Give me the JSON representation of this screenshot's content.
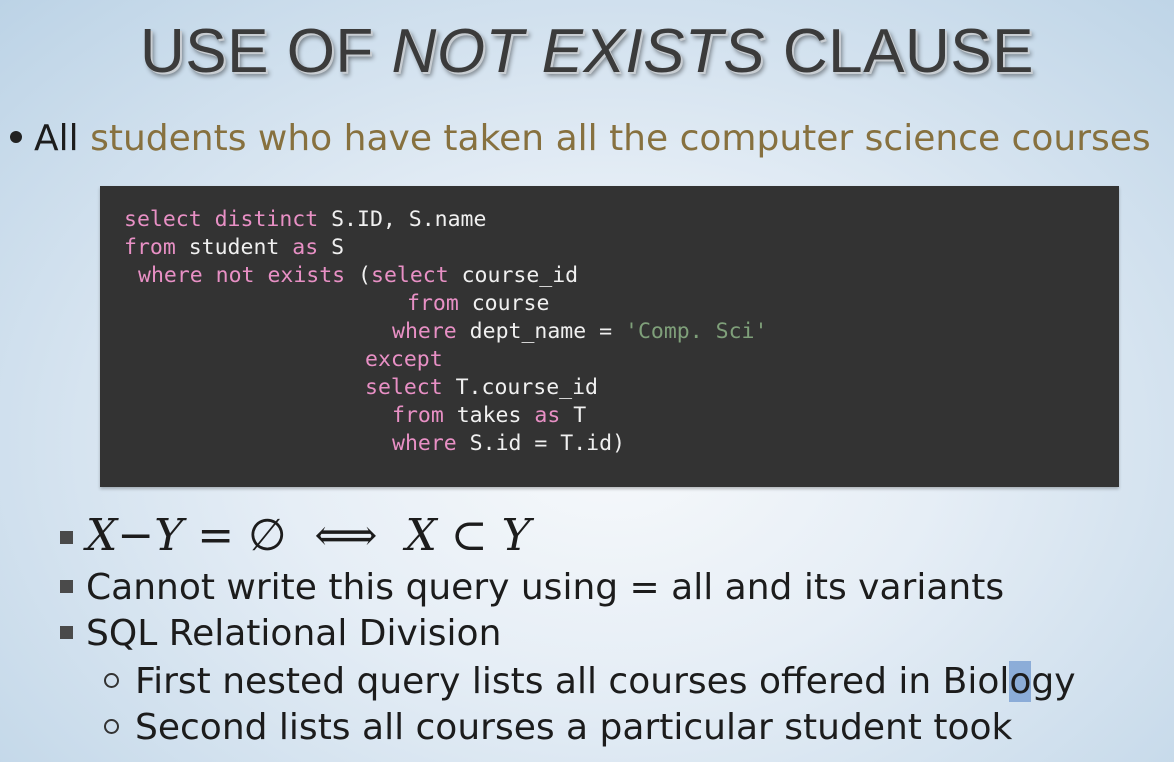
{
  "title": {
    "part1": "USE OF",
    "part2": "NOT EXISTS",
    "part3": "CLAUSE"
  },
  "main_bullet": {
    "lead": "All",
    "accent": "students who have taken all the computer science courses"
  },
  "code": {
    "line1": {
      "kw1": "select distinct",
      "rest": " S.ID, S.name"
    },
    "line2": {
      "kw1": "from",
      "mid": " student ",
      "kw2": "as",
      "rest": " S"
    },
    "line3": {
      "kw1": "where not exists",
      "mid": " (",
      "kw2": "select",
      "rest": " course_id"
    },
    "line4": {
      "kw1": "from",
      "rest": " course"
    },
    "line5": {
      "kw1": "where",
      "mid": " dept_name = ",
      "str": "'Comp. Sci'"
    },
    "line6": {
      "kw1": "except"
    },
    "line7": {
      "kw1": "select",
      "rest": " T.course_id"
    },
    "line8": {
      "kw1": "from",
      "mid": " takes ",
      "kw2": "as",
      "rest": " T"
    },
    "line9": {
      "kw1": "where",
      "rest": " S.id = T.id)"
    }
  },
  "sub_bullets": [
    {
      "math": {
        "x": "X",
        "minus": "−",
        "y": "Y",
        "eq": " = ∅  ⟺  ",
        "x2": "X",
        "subset": " ⊂ ",
        "y2": "Y"
      }
    },
    {
      "text": "Cannot write this query using = all and its variants"
    },
    {
      "text": "SQL Relational Division"
    }
  ],
  "subsub_bullets": [
    {
      "before": "First nested query lists all courses offered in Biol",
      "highlight": "o",
      "after": "gy"
    },
    {
      "text": "Second lists all courses a particular student took"
    }
  ]
}
